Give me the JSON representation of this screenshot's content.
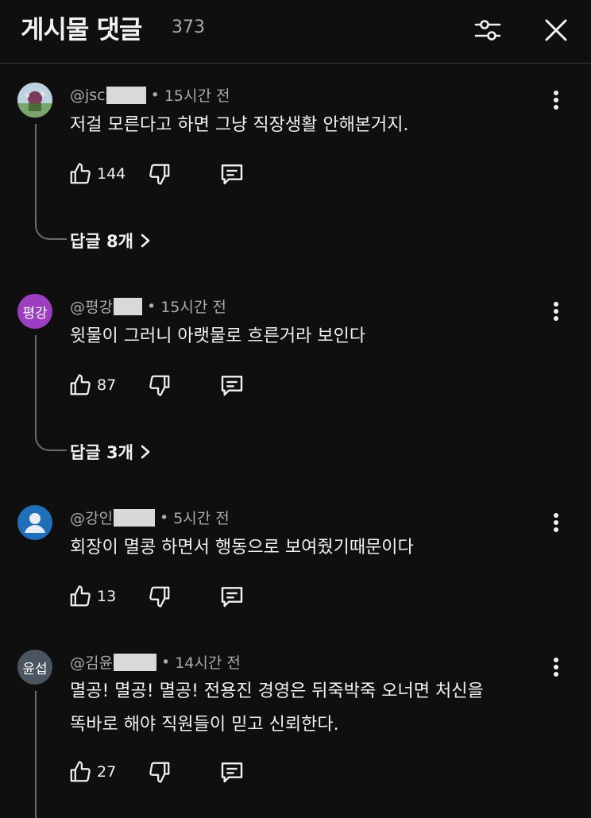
{
  "header": {
    "title": "게시물 댓글",
    "count": "373",
    "filter_icon": "sliders-icon",
    "close_icon": "close-icon"
  },
  "comments": [
    {
      "author": "@jsc",
      "time": "15시간 전",
      "text": [
        "저걸 모른다고 하면 그냥 직장생활 안해본거지."
      ],
      "likes": "144",
      "replies": "답글 8개",
      "avatar": {
        "type": "image"
      }
    },
    {
      "author": "@평강",
      "time": "15시간 전",
      "text": [
        "윗물이 그러니 아랫물로 흐른거라 보인다"
      ],
      "likes": "87",
      "replies": "답글 3개",
      "avatar": {
        "type": "initials",
        "label": "평강",
        "color": "#9b3fc0"
      }
    },
    {
      "author": "@강인",
      "time": "5시간 전",
      "text": [
        "회장이 멸콩 하면서 행동으로 보여줬기때문이다"
      ],
      "likes": "13",
      "avatar": {
        "type": "default",
        "color": "#1f6fb8"
      }
    },
    {
      "author": "@김윤",
      "time": "14시간 전",
      "text": [
        "멸공! 멸공! 멸공!  전용진  경영은 뒤죽박죽  오너면  처신을",
        "똑바로 해야 직원들이 믿고  신뢰한다."
      ],
      "likes": "27",
      "avatar": {
        "type": "initials",
        "label": "윤섭",
        "color": "#4a5560"
      }
    }
  ],
  "colors": {
    "background": "#0f0f0f",
    "text": "#f1f1f1",
    "secondary": "#aaaaaa",
    "divider": "#3a3a3a"
  }
}
